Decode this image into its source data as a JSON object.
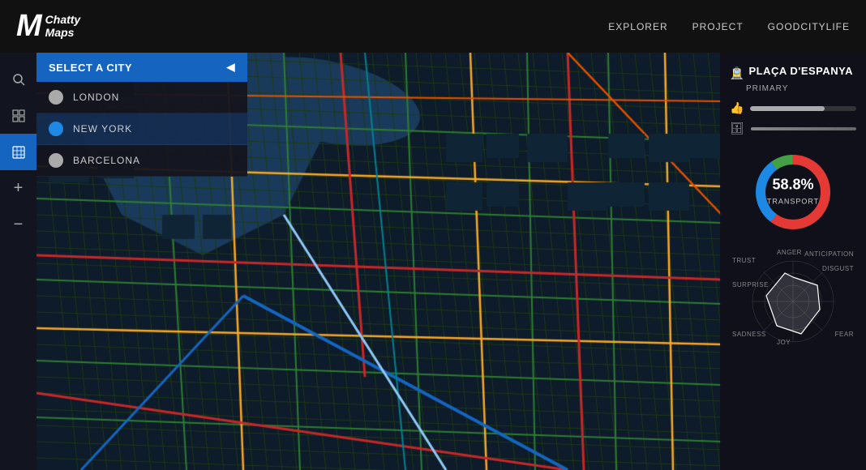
{
  "nav": {
    "logo_m": "M",
    "logo_chatty": "Chatty",
    "logo_maps": "Maps",
    "links": [
      "EXPLORER",
      "PROJECT",
      "GOODCITYLIFE"
    ]
  },
  "sidebar": {
    "buttons": [
      {
        "name": "search-btn",
        "icon": "🔍",
        "active": false
      },
      {
        "name": "layers-btn",
        "icon": "⊞",
        "active": false
      },
      {
        "name": "map-btn",
        "icon": "🗺",
        "active": true
      },
      {
        "name": "zoom-in-btn",
        "icon": "🔍",
        "active": false,
        "label": "+"
      },
      {
        "name": "zoom-out-btn",
        "icon": "🔍",
        "active": false,
        "label": "−"
      }
    ]
  },
  "city_dropdown": {
    "header": "SELECT A CITY",
    "cities": [
      {
        "name": "LONDON",
        "selected": false
      },
      {
        "name": "NEW YORK",
        "selected": true
      },
      {
        "name": "BARCELONA",
        "selected": false
      }
    ]
  },
  "right_panel": {
    "location_name": "Plaça d'Espanya",
    "location_type": "PRIMARY",
    "progress": 70,
    "donut": {
      "percent": "58.8%",
      "type": "TRANSPORT"
    },
    "radar_labels": [
      "ANGER",
      "ANTICIPATION",
      "DISGUST",
      "FEAR",
      "JOY",
      "SADNESS",
      "SURPRISE",
      "TRUST"
    ]
  }
}
